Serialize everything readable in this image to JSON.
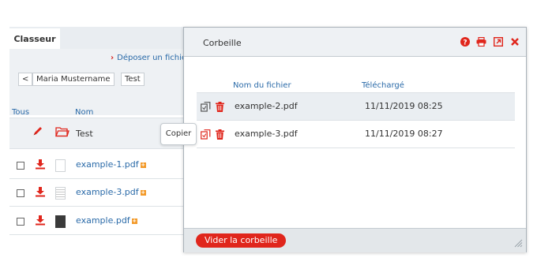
{
  "classeur": {
    "tab_label": "Classeur",
    "deposit_label": "Déposer un fichier",
    "breadcrumb": {
      "back_label": "<",
      "user_label": "Maria Mustername",
      "folder_label": "Test"
    },
    "columns": {
      "all_label": "Tous",
      "name_label": "Nom"
    },
    "folder_row": {
      "name": "Test"
    },
    "files": [
      {
        "name": "example-1.pdf",
        "thumbnail": "blank"
      },
      {
        "name": "example-3.pdf",
        "thumbnail": "lines"
      },
      {
        "name": "example.pdf",
        "thumbnail": "dark"
      }
    ]
  },
  "tooltip": {
    "label": "Copier"
  },
  "corbeille": {
    "title": "Corbeille",
    "header_icons": [
      "help-icon",
      "print-icon",
      "popout-icon",
      "close-icon"
    ],
    "columns": {
      "filename_label": "Nom du fichier",
      "uploaded_label": "Téléchargé"
    },
    "rows": [
      {
        "name": "example-2.pdf",
        "date": "11/11/2019 08:25",
        "selected": true
      },
      {
        "name": "example-3.pdf",
        "date": "11/11/2019 08:27",
        "selected": false
      }
    ],
    "empty_button_label": "Vider la corbeille"
  },
  "colors": {
    "accent_red": "#e0261c",
    "link_blue": "#2a6aa8",
    "header_gray": "#eef1f4"
  }
}
